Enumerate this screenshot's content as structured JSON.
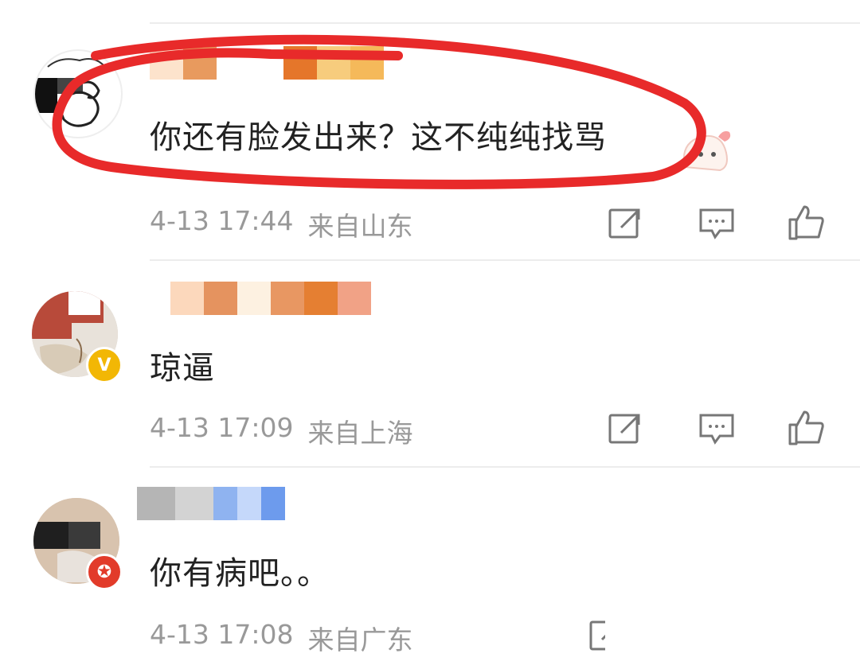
{
  "comments": [
    {
      "text": "你还有脸发出来？这不纯纯找骂",
      "time": "4-13 17:44",
      "location": "来自山东",
      "username_pixels": [
        "#fde3cc",
        "#e89a5e",
        "#ffffff",
        "#ffffff",
        "#e5762a",
        "#f7cc7d",
        "#f5b95a"
      ]
    },
    {
      "text": "琼逼",
      "time": "4-13 17:09",
      "location": "来自上海",
      "badge": "V",
      "badge_color": "#f2b705",
      "username_pixels": [
        "#fcd8bc",
        "#e5935f",
        "#fdf1e1",
        "#e89762",
        "#e57f32",
        "#f1a286"
      ]
    },
    {
      "text": "你有病吧。。",
      "time": "4-13 17:08",
      "location": "来自广东",
      "badge": "✪",
      "badge_color": "#e23b2a",
      "username_pixels": [
        "#b5b5b5",
        "#d3d3d3",
        "#8fb3f0",
        "#c5d8fa",
        "#6d9bed"
      ]
    }
  ],
  "icons": {
    "repost": "repost-icon",
    "comment": "comment-icon",
    "like": "like-icon"
  },
  "colors": {
    "annotation_red": "#e82a2a",
    "meta_gray": "#999999",
    "icon_gray": "#777777"
  }
}
